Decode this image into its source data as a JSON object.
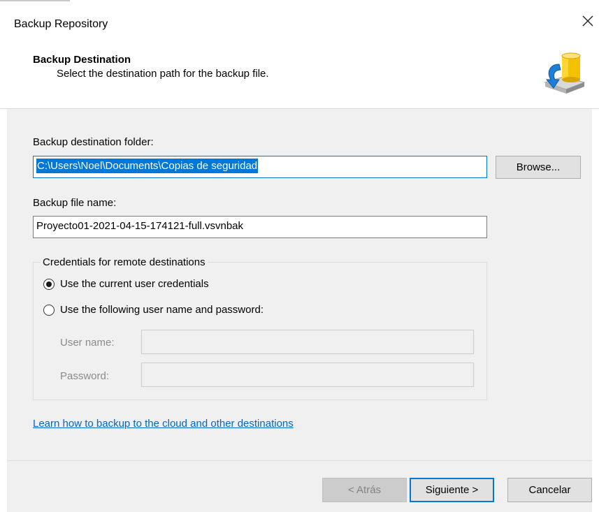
{
  "window": {
    "title": "Backup Repository",
    "close_glyph": "×"
  },
  "header": {
    "title": "Backup Destination",
    "subtitle": "Select the destination path for the backup file.",
    "icon": "database-backup-icon"
  },
  "form": {
    "folder_label": "Backup destination folder:",
    "folder_value": "C:\\Users\\Noel\\Documents\\Copias de seguridad",
    "browse_label": "Browse...",
    "filename_label": "Backup file name:",
    "filename_value": "Proyecto01-2021-04-15-174121-full.vsvnbak"
  },
  "credentials": {
    "legend": "Credentials for remote destinations",
    "option_current": "Use the current user credentials",
    "option_following": "Use the following user name and password:",
    "selected": "current",
    "username_label": "User name:",
    "username_value": "",
    "password_label": "Password:",
    "password_value": ""
  },
  "links": {
    "cloud": "Learn how to backup to the cloud and other destinations"
  },
  "footer": {
    "back_label": "< Atrás",
    "next_label": "Siguiente >",
    "cancel_label": "Cancelar"
  },
  "colors": {
    "accent": "#0078d7",
    "link": "#0066cc",
    "panel": "#f0f0f0"
  }
}
